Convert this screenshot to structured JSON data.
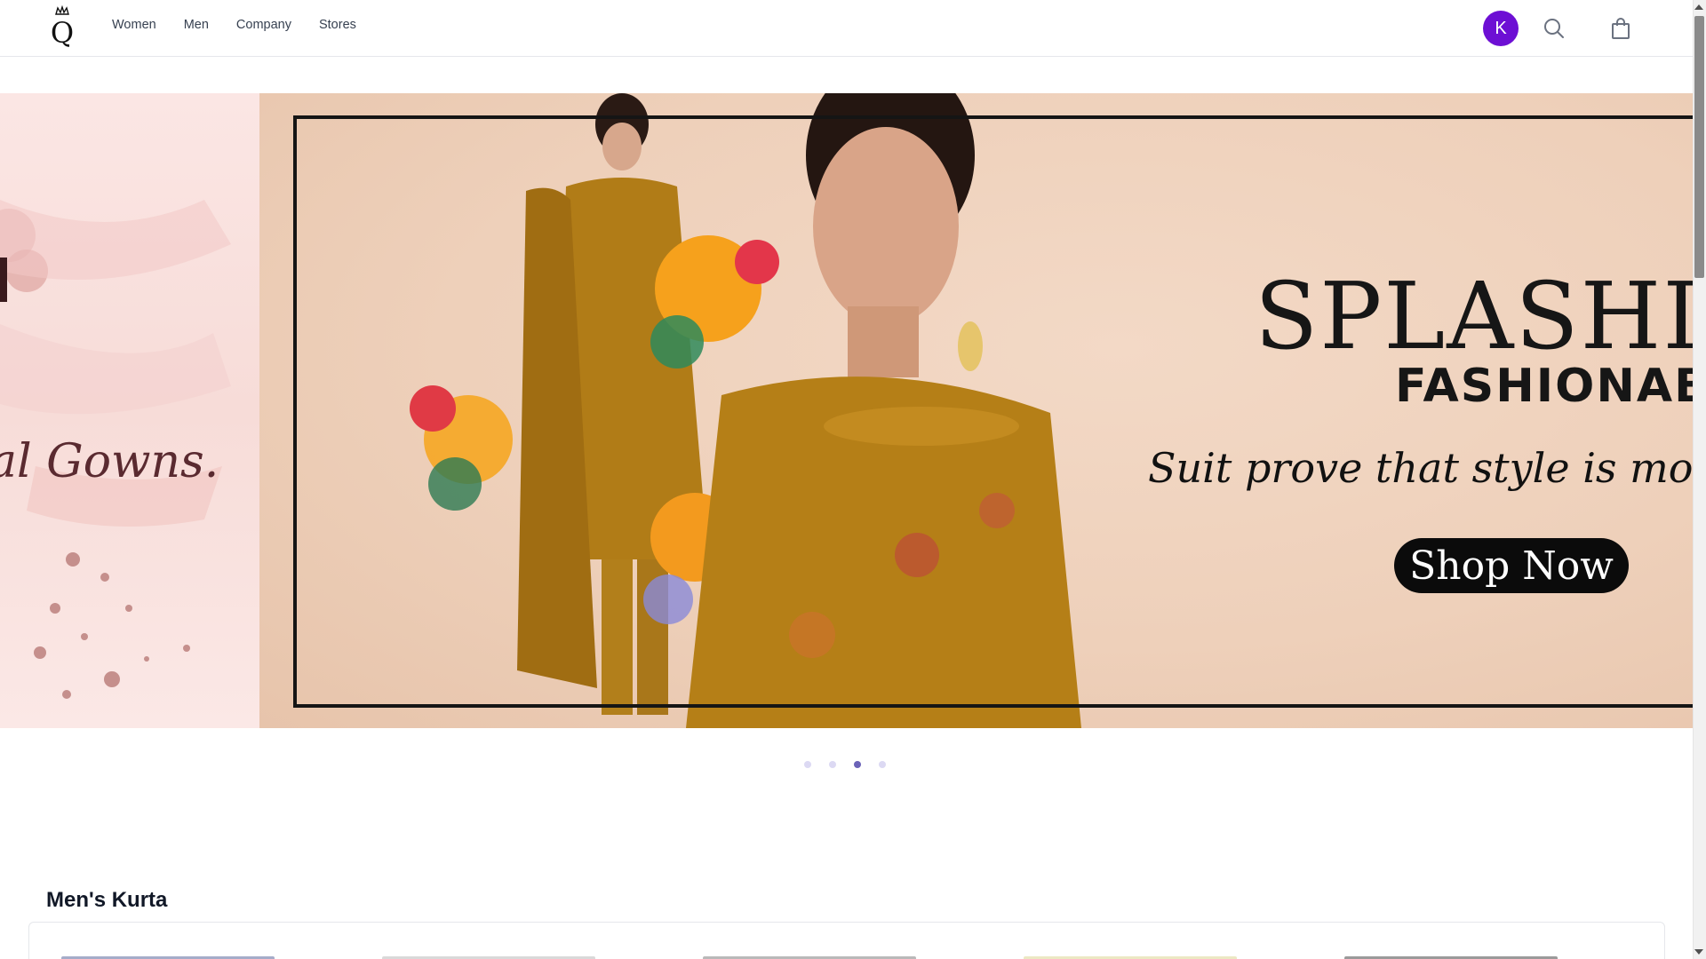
{
  "header": {
    "logo_icon": "crown-q-logo",
    "nav": [
      {
        "label": "Women"
      },
      {
        "label": "Men"
      },
      {
        "label": "Company"
      },
      {
        "label": "Stores"
      }
    ],
    "avatar_initial": "K",
    "avatar_color": "#6d0fd4",
    "search_icon": "search-icon",
    "cart_icon": "shopping-bag-icon"
  },
  "hero": {
    "left_slide_text": "al Gowns.",
    "title": "SPLASHING",
    "subtitle": "FASHIONABL",
    "tagline": "Suit prove that style is more about (",
    "cta": "Shop Now",
    "slides": 4,
    "active_slide": 3,
    "accent_color": "#6b63b8"
  },
  "section": {
    "title": "Men's Kurta"
  }
}
